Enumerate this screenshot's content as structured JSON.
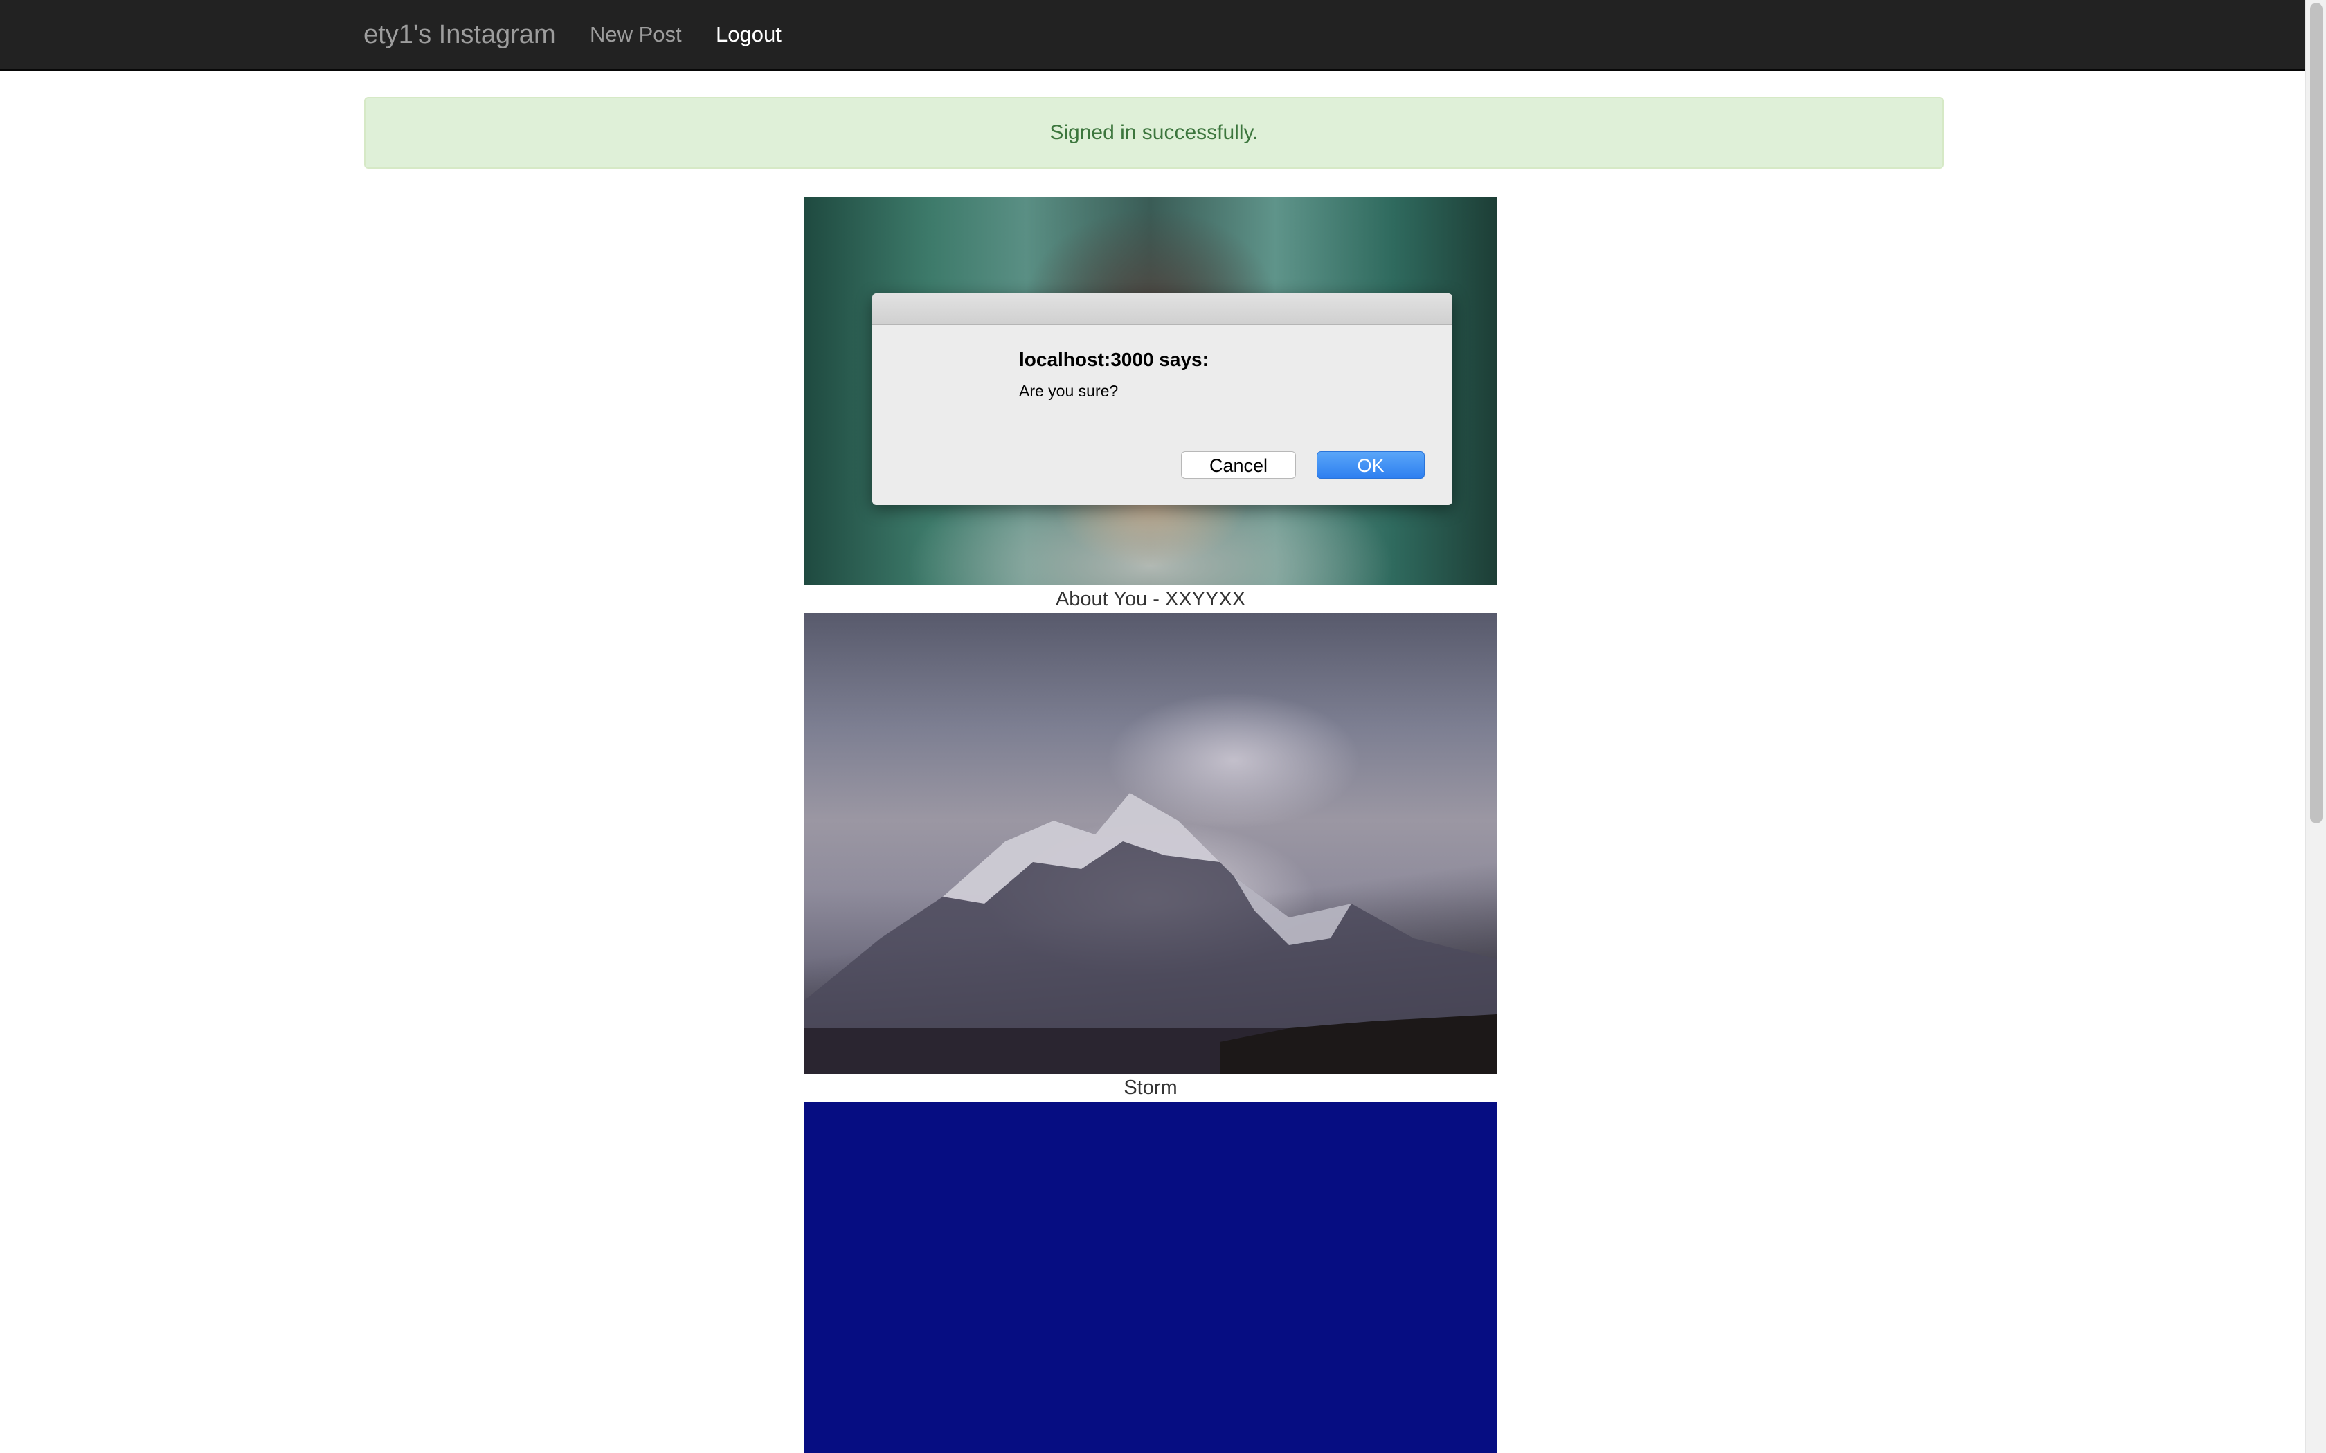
{
  "navbar": {
    "brand": "ety1's Instagram",
    "links": [
      {
        "label": "New Post"
      },
      {
        "label": "Logout"
      }
    ]
  },
  "flash": {
    "message": "Signed in successfully."
  },
  "posts": [
    {
      "caption": "About You - XXYYXX"
    },
    {
      "caption": "Storm"
    },
    {
      "caption": ""
    }
  ],
  "dialog": {
    "title": "localhost:3000 says:",
    "message": "Are you sure?",
    "cancel_label": "Cancel",
    "ok_label": "OK"
  },
  "colors": {
    "navbar_bg": "#222222",
    "flash_bg": "#dff0d8",
    "flash_text": "#3c763d",
    "ok_button": "#3a8cf3",
    "post3_fill": "#060d82"
  }
}
